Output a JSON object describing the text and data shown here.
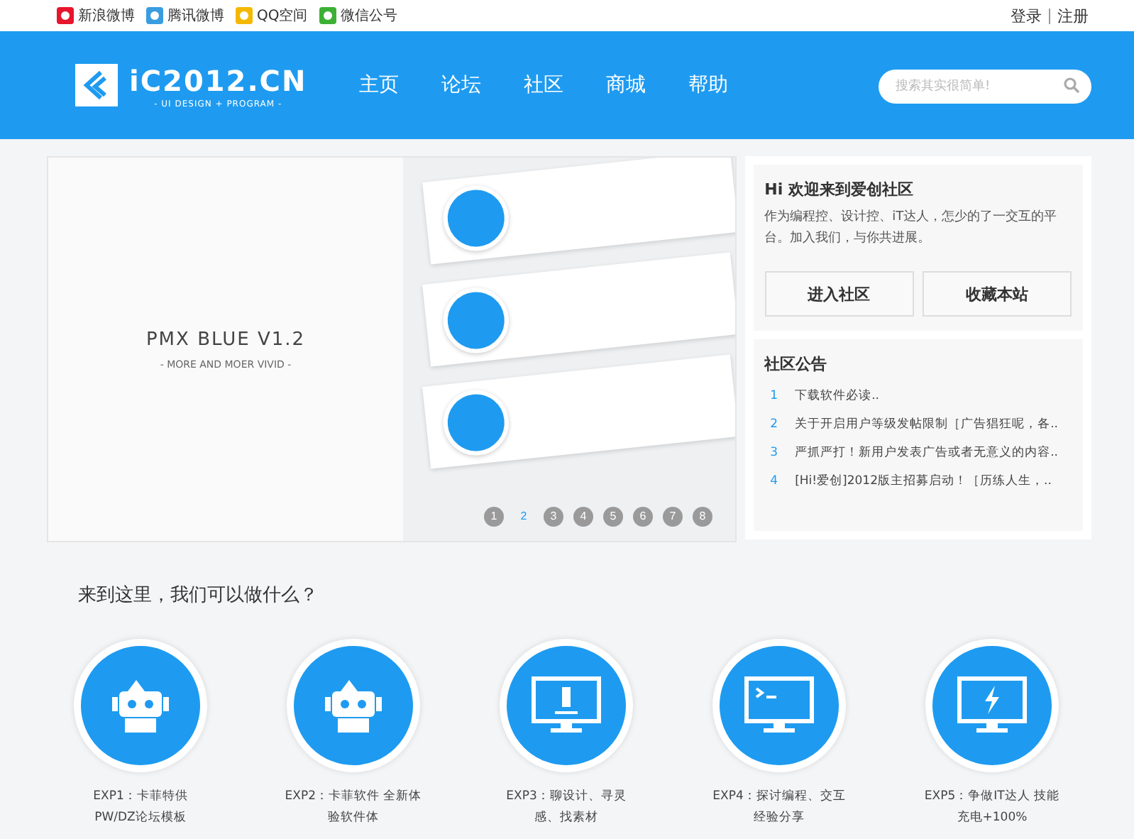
{
  "top_links": [
    {
      "label": "新浪微博",
      "kind": "weibo"
    },
    {
      "label": "腾讯微博",
      "kind": "tweibo"
    },
    {
      "label": "QQ空间",
      "kind": "qzone"
    },
    {
      "label": "微信公号",
      "kind": "wechat"
    }
  ],
  "account_links": [
    "登录",
    "注册"
  ],
  "logo": {
    "text": "iC2012.CN",
    "tagline": "- UI DESIGN + PROGRAM -"
  },
  "nav": [
    "主页",
    "论坛",
    "社区",
    "商城",
    "帮助"
  ],
  "search": {
    "placeholder": "搜索其实很简单!"
  },
  "banner": {
    "title": "PMX BLUE V1.2",
    "subtitle": "- MORE AND MOER VIVID -",
    "pages": [
      {
        "label": "1",
        "selected": false
      },
      {
        "label": "2",
        "selected": true
      },
      {
        "label": "3",
        "selected": false
      },
      {
        "label": "4",
        "selected": false
      },
      {
        "label": "5",
        "selected": false
      },
      {
        "label": "6",
        "selected": false
      },
      {
        "label": "7",
        "selected": false
      },
      {
        "label": "8",
        "selected": false
      }
    ]
  },
  "welcome": {
    "title": "Hi 欢迎来到爱创社区",
    "text": "作为编程控、设计控、iT达人，怎少的了一交互的平台。加入我们，与你共进展。",
    "buttons": [
      "进入社区",
      "收藏本站"
    ]
  },
  "notices": {
    "title": "社区公告",
    "items": [
      {
        "number": "1",
        "text": "下载软件必读.."
      },
      {
        "number": "2",
        "text": "关于开启用户等级发帖限制［广告猖狂呢，各.."
      },
      {
        "number": "3",
        "text": "严抓严打！新用户发表广告或者无意义的内容.."
      },
      {
        "number": "4",
        "text": "[Hi!爱创]2012版主招募启动！［历练人生，.."
      }
    ]
  },
  "features": {
    "heading": "来到这里，我们可以做什么？",
    "items": [
      {
        "kind": "robot",
        "caption": "EXP1：卡菲特供 PW/DZ论坛模板"
      },
      {
        "kind": "robot",
        "caption": "EXP2：卡菲软件 全新体验软件体"
      },
      {
        "kind": "pen",
        "caption": "EXP3：聊设计、寻灵感、找素材"
      },
      {
        "kind": "terminal",
        "caption": "EXP4：探讨编程、交互经验分享"
      },
      {
        "kind": "bolt",
        "caption": "EXP5：争做IT达人 技能充电+100%"
      }
    ]
  }
}
